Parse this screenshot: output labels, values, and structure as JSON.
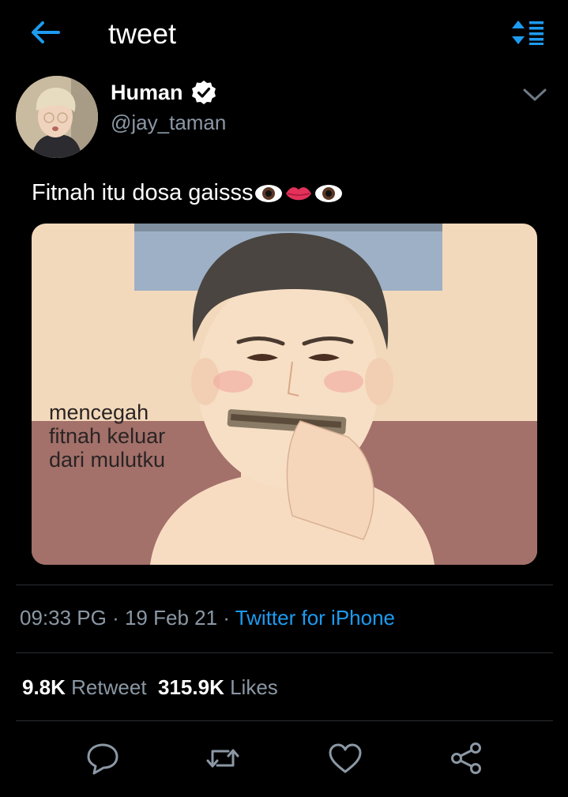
{
  "header": {
    "title": "tweet",
    "back_icon": "back-arrow-icon",
    "sort_icon": "sort-icon"
  },
  "author": {
    "name": "Human",
    "handle": "@jay_taman",
    "verified": true
  },
  "tweet": {
    "text": "Fitnah itu dosa gaisss",
    "emojis": [
      "eye",
      "lips",
      "eye"
    ],
    "image": {
      "caption_lines": [
        "mencegah",
        "fitnah keluar",
        "dari mulutku"
      ]
    }
  },
  "meta": {
    "time": "09:33 PG",
    "sep1": " · ",
    "date": "19 Feb 21",
    "sep2": " · ",
    "source": "Twitter for iPhone"
  },
  "stats": {
    "retweets": "9.8K",
    "retweets_label": "Retweet",
    "likes": "315.9K",
    "likes_label": "Likes"
  },
  "actions": [
    "reply-icon",
    "retweet-icon",
    "like-icon",
    "share-icon"
  ],
  "colors": {
    "accent": "#1d9bf0",
    "muted": "#8b98a5",
    "background": "#000000"
  }
}
